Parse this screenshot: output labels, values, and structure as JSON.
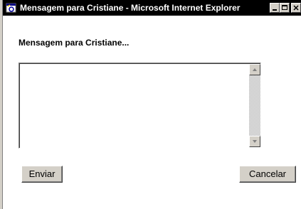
{
  "window": {
    "title": "Mensagem para Cristiane - Microsoft Internet Explorer",
    "icon": "internet-explorer-icon"
  },
  "form": {
    "prompt": "Mensagem para Cristiane...",
    "message_value": "",
    "send_label": "Enviar",
    "cancel_label": "Cancelar"
  },
  "colors": {
    "titlebar": "#000000",
    "face": "#d4d0c8",
    "background": "#ffffff"
  }
}
